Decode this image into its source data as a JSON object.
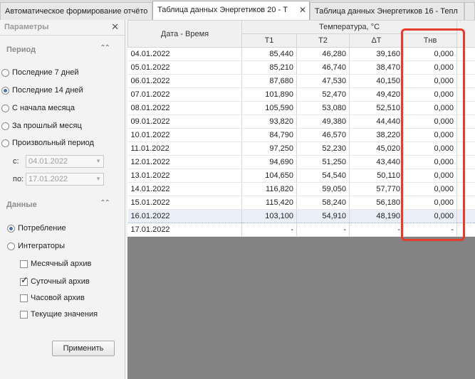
{
  "tabs": [
    {
      "label": "Автоматическое формирование отчёто",
      "active": false
    },
    {
      "label": "Таблица данных Энергетиков 20 - Т",
      "active": true
    },
    {
      "label": "Таблица данных Энергетиков 16 - Тепл",
      "active": false
    }
  ],
  "panel": {
    "title": "Параметры",
    "period_title": "Период",
    "period_options": [
      "Последние 7 дней",
      "Последние 14 дней",
      "С начала месяца",
      "За прошлый месяц",
      "Произвольный период"
    ],
    "period_selected": 1,
    "from_label": "с:",
    "from_value": "04.01.2022",
    "to_label": "по:",
    "to_value": "17.01.2022",
    "data_title": "Данные",
    "data_options": [
      "Потребление",
      "Интеграторы"
    ],
    "data_selected": 0,
    "archives": [
      {
        "label": "Месячный архив",
        "checked": false
      },
      {
        "label": "Суточный архив",
        "checked": true
      },
      {
        "label": "Часовой архив",
        "checked": false
      },
      {
        "label": "Текущие значения",
        "checked": false
      }
    ],
    "apply_label": "Применить"
  },
  "grid": {
    "col_date": "Дата - Время",
    "group_header": "Температура, °C",
    "cols": [
      "T1",
      "T2",
      "ΔT",
      "Tнв"
    ],
    "rows": [
      [
        "04.01.2022",
        "85,440",
        "46,280",
        "39,160",
        "0,000"
      ],
      [
        "05.01.2022",
        "85,210",
        "46,740",
        "38,470",
        "0,000"
      ],
      [
        "06.01.2022",
        "87,680",
        "47,530",
        "40,150",
        "0,000"
      ],
      [
        "07.01.2022",
        "101,890",
        "52,470",
        "49,420",
        "0,000"
      ],
      [
        "08.01.2022",
        "105,590",
        "53,080",
        "52,510",
        "0,000"
      ],
      [
        "09.01.2022",
        "93,820",
        "49,380",
        "44,440",
        "0,000"
      ],
      [
        "10.01.2022",
        "84,790",
        "46,570",
        "38,220",
        "0,000"
      ],
      [
        "11.01.2022",
        "97,250",
        "52,230",
        "45,020",
        "0,000"
      ],
      [
        "12.01.2022",
        "94,690",
        "51,250",
        "43,440",
        "0,000"
      ],
      [
        "13.01.2022",
        "104,650",
        "54,540",
        "50,110",
        "0,000"
      ],
      [
        "14.01.2022",
        "116,820",
        "59,050",
        "57,770",
        "0,000"
      ],
      [
        "15.01.2022",
        "115,420",
        "58,240",
        "56,180",
        "0,000"
      ],
      [
        "16.01.2022",
        "103,100",
        "54,910",
        "48,190",
        "0,000"
      ],
      [
        "17.01.2022",
        "-",
        "-",
        "-",
        "-"
      ]
    ],
    "selected_row": 12
  },
  "colors": {
    "highlight": "#e53c2c",
    "empty_area": "#838383",
    "radio_accent": "#4a72b0"
  }
}
